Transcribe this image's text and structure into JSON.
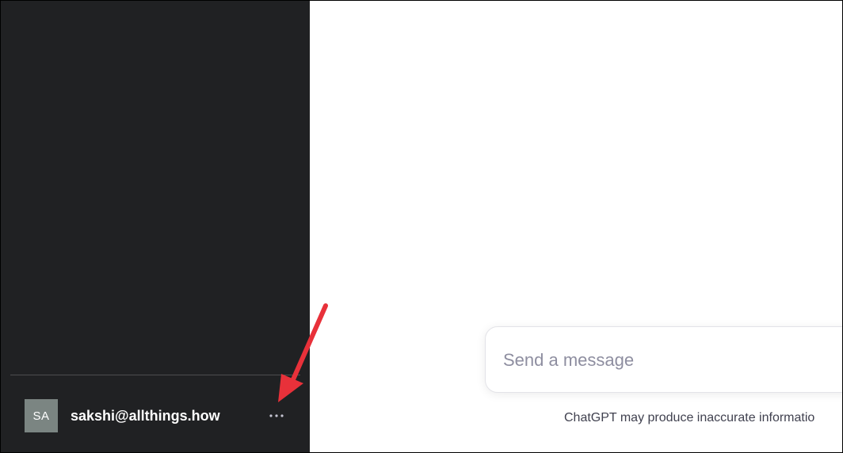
{
  "sidebar": {
    "account": {
      "avatar_initials": "SA",
      "email": "sakshi@allthings.how",
      "more_icon": "ellipsis-icon"
    }
  },
  "main": {
    "composer": {
      "placeholder": "Send a message",
      "value": ""
    },
    "disclaimer": "ChatGPT may produce inaccurate informatio"
  },
  "annotation": {
    "arrow_color": "#e8313a"
  },
  "colors": {
    "sidebar_bg": "#202123",
    "avatar_bg": "#7b8582",
    "placeholder": "#8e8ea0"
  }
}
